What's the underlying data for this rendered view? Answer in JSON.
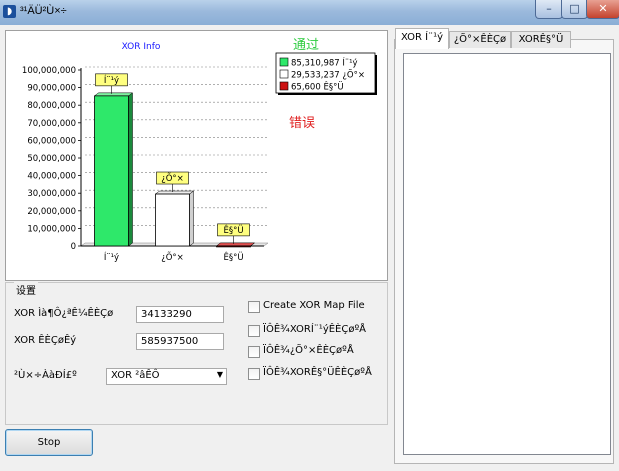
{
  "window": {
    "title": "³¹ÄÜ²Ù×÷",
    "minimize_glyph": "–",
    "maximize_glyph": "□",
    "close_glyph": "✕"
  },
  "chart_data": {
    "type": "bar",
    "title": "XOR Info",
    "categories": [
      "Í¨¹ý",
      "¿Õ°×",
      "Ê§°Ü"
    ],
    "values": [
      85310987,
      29533237,
      65600
    ],
    "value_labels": [
      "Í¨¹ý",
      "¿Õ°×",
      "Ê§°Ü"
    ],
    "colors": [
      "#2ee86a",
      "#ffffff",
      "#cc1111"
    ],
    "ylim": [
      0,
      100000000
    ],
    "yticks": [
      "0",
      "10,000,000",
      "20,000,000",
      "30,000,000",
      "40,000,000",
      "50,000,000",
      "60,000,000",
      "70,000,000",
      "80,000,000",
      "90,000,000",
      "100,000,000"
    ],
    "grid": true,
    "legend": {
      "placement": "top-right",
      "entries": [
        {
          "value": "85,310,987",
          "label": "Í¨¹ý",
          "color": "#2ee86a"
        },
        {
          "value": "29,533,237",
          "label": "¿Õ°×",
          "color": "#ffffff"
        },
        {
          "value": "65,600",
          "label": "Ê§°Ü",
          "color": "#cc1111"
        }
      ]
    },
    "annotations": {
      "pass": "通过",
      "fail": "错误"
    }
  },
  "settings": {
    "group_label": "设置",
    "start_label": "XOR Ìà¶Ô¿ªÊ¼ÊÈÇø",
    "start_value": "34133290",
    "count_label": "XOR ÊÈÇøÊý",
    "count_value": "585937500",
    "mode_label": "²Ù×÷ÀàÐÍ£º",
    "mode_value": "XOR ²âÊÔ",
    "create_map_label": "Create XOR Map File",
    "check1_label": "ÏÔÊ¾XORÍ¨¹ýÊÈÇøºÅ",
    "check2_label": "ÏÔÊ¾¿Õ°×ÊÈÇøºÅ",
    "check3_label": "ÏÔÊ¾XORÊ§°ÜÊÈÇøºÅ"
  },
  "stop_button_label": "Stop",
  "tabs": [
    {
      "label": "XOR Í¨¹ý"
    },
    {
      "label": "¿Õ°×ÊÈÇø"
    },
    {
      "label": "XORÊ§°Ü"
    }
  ]
}
